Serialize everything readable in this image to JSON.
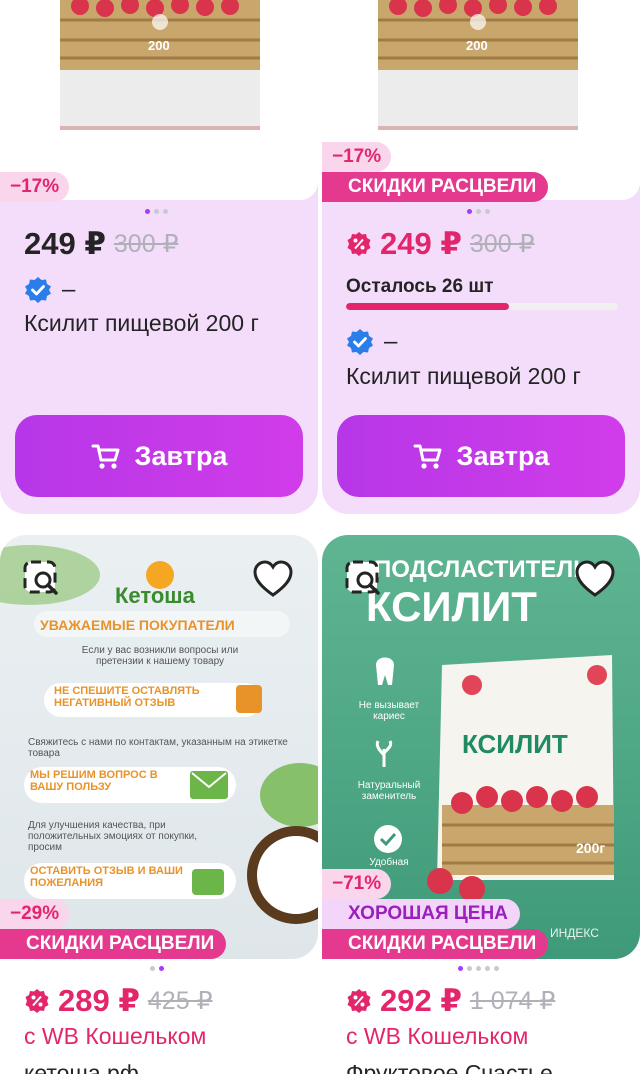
{
  "cards": [
    {
      "discount": "−17%",
      "price": "249 ₽",
      "old_price": "300 ₽",
      "seller": "–",
      "title": "Ксилит пищевой 200 г",
      "button": "Завтра",
      "image_text": "200"
    },
    {
      "discount": "−17%",
      "promo": "СКИДКИ РАСЦВЕЛИ",
      "price": "249 ₽",
      "old_price": "300 ₽",
      "stock": "Осталось 26 шт",
      "stock_level": 0.6,
      "seller": "–",
      "title": "Ксилит пищевой 200 г",
      "button": "Завтра",
      "image_text": "200"
    },
    {
      "discount": "−29%",
      "promo": "СКИДКИ РАСЦВЕЛИ",
      "price": "289 ₽",
      "old_price": "425 ₽",
      "wallet": "с WB Кошельком",
      "below": "кетоша.рф",
      "image": {
        "brand": "Кетоша",
        "headline": "УВАЖАЕМЫЕ ПОКУПАТЕЛИ",
        "text1": "Если у вас возникли вопросы или претензии к нашему товару",
        "callout1": "НЕ СПЕШИТЕ ОСТАВЛЯТЬ НЕГАТИВНЫЙ ОТЗЫВ",
        "text2": "Свяжитесь с нами по контактам, указанным на этикетке товара",
        "callout2": "МЫ РЕШИМ ВОПРОС В ВАШУ ПОЛЬЗУ",
        "text3": "Для улучшения качества, при положительных эмоциях от покупки, просим",
        "callout3": "ОСТАВИТЬ ОТЗЫВ И ВАШИ ПОЖЕЛАНИЯ"
      }
    },
    {
      "discount": "−71%",
      "good": "ХОРОШАЯ ЦЕНА",
      "promo": "СКИДКИ РАСЦВЕЛИ",
      "price": "292 ₽",
      "old_price": "1 074 ₽",
      "wallet": "с WB Кошельком",
      "below": "Фруктовое Счастье",
      "image": {
        "top": "ПОДСЛАСТИТЕЛЬ",
        "headline": "КСИЛИТ",
        "f1": "Не вызывает кариес",
        "f2": "Натуральный заменитель",
        "f3": "Удобная",
        "pack": "КСИЛИТ",
        "weight": "200г",
        "corner": "ИНДЕКС"
      }
    }
  ],
  "colors": {
    "accent": "#a73afd",
    "promo": "#e5398f",
    "price_red": "#e3266c",
    "card_bg": "#f4ddfb"
  }
}
